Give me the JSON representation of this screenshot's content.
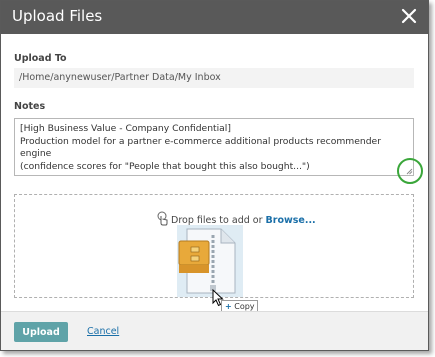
{
  "dialog": {
    "title": "Upload Files",
    "close_icon": "close-icon"
  },
  "upload_to": {
    "label": "Upload To",
    "value": "/Home/anynewuser/Partner Data/My Inbox"
  },
  "notes": {
    "label": "Notes",
    "value": "[High Business Value - Company Confidential]\nProduction model for a partner e-commerce additional products recommender engine\n(confidence scores for \"People that bought this also bought...\")"
  },
  "dropzone": {
    "text": "Drop files to add or ",
    "browse_label": "Browse...",
    "icons": [
      "touch-icon",
      "zip-file-icon",
      "arrow-cursor-icon"
    ]
  },
  "drag_tooltip": {
    "plus": "+",
    "label": "Copy"
  },
  "footer": {
    "upload_label": "Upload",
    "cancel_label": "Cancel"
  },
  "colors": {
    "titlebar": "#595959",
    "accent": "#5fa3a8",
    "link": "#1a6fa8",
    "highlight_ring": "#3aa63a"
  }
}
